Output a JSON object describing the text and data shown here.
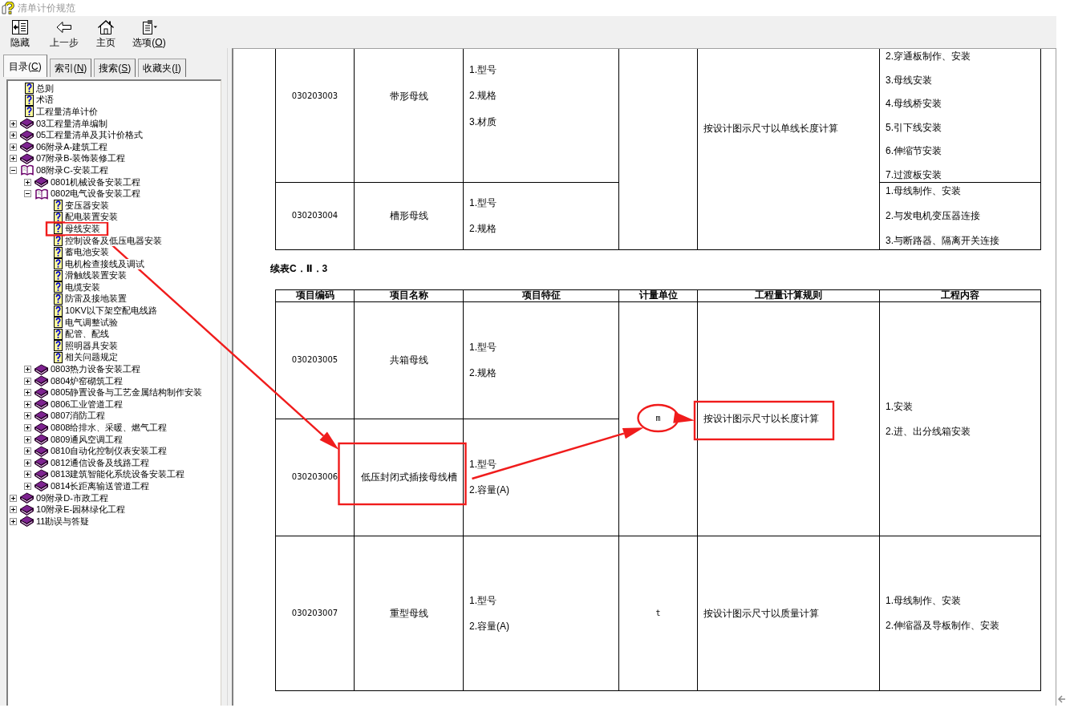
{
  "window": {
    "title": "清单计价规范"
  },
  "toolbar": [
    {
      "label": "隐藏",
      "kind": "hide"
    },
    {
      "label": "上一步",
      "kind": "back"
    },
    {
      "label": "主页",
      "kind": "home"
    },
    {
      "label": "选项(O)",
      "kind": "options"
    }
  ],
  "tabs": [
    {
      "label": "目录(C)",
      "selected": true
    },
    {
      "label": "索引(N)",
      "selected": false
    },
    {
      "label": "搜索(S)",
      "selected": false
    },
    {
      "label": "收藏夹(I)",
      "selected": false
    }
  ],
  "tree": [
    {
      "label": "总则",
      "kind": "page",
      "highlighted": false
    },
    {
      "label": "术语",
      "kind": "page",
      "highlighted": false
    },
    {
      "label": "工程量清单计价",
      "kind": "page",
      "highlighted": false
    },
    {
      "label": "03工程量清单编制",
      "kind": "book",
      "expanded": false,
      "highlighted": false
    },
    {
      "label": "05工程量清单及其计价格式",
      "kind": "book",
      "expanded": false,
      "highlighted": false
    },
    {
      "label": "06附录A-建筑工程",
      "kind": "book",
      "expanded": false,
      "highlighted": false
    },
    {
      "label": "07附录B-装饰装修工程",
      "kind": "book",
      "expanded": false,
      "highlighted": false
    },
    {
      "label": "08附录C-安装工程",
      "kind": "book",
      "expanded": true,
      "highlighted": false,
      "children": [
        {
          "label": "0801机械设备安装工程",
          "kind": "book",
          "expanded": false,
          "highlighted": false
        },
        {
          "label": "0802电气设备安装工程",
          "kind": "book",
          "expanded": true,
          "highlighted": false,
          "children": [
            {
              "label": "变压器安装",
              "kind": "page",
              "highlighted": false
            },
            {
              "label": "配电装置安装",
              "kind": "page",
              "highlighted": false
            },
            {
              "label": "母线安装",
              "kind": "page",
              "highlighted": true
            },
            {
              "label": "控制设备及低压电器安装",
              "kind": "page",
              "highlighted": false
            },
            {
              "label": "蓄电池安装",
              "kind": "page",
              "highlighted": false
            },
            {
              "label": "电机检查接线及调试",
              "kind": "page",
              "highlighted": false
            },
            {
              "label": "滑触线装置安装",
              "kind": "page",
              "highlighted": false
            },
            {
              "label": "电缆安装",
              "kind": "page",
              "highlighted": false
            },
            {
              "label": "防雷及接地装置",
              "kind": "page",
              "highlighted": false
            },
            {
              "label": "10KV以下架空配电线路",
              "kind": "page",
              "highlighted": false
            },
            {
              "label": "电气调整试验",
              "kind": "page",
              "highlighted": false
            },
            {
              "label": "配管、配线",
              "kind": "page",
              "highlighted": false
            },
            {
              "label": "照明器具安装",
              "kind": "page",
              "highlighted": false
            },
            {
              "label": "相关问题规定",
              "kind": "page",
              "highlighted": false
            }
          ]
        },
        {
          "label": "0803热力设备安装工程",
          "kind": "book",
          "expanded": false,
          "highlighted": false
        },
        {
          "label": "0804炉窑砌筑工程",
          "kind": "book",
          "expanded": false,
          "highlighted": false
        },
        {
          "label": "0805静置设备与工艺金属结构制作安装",
          "kind": "book",
          "expanded": false,
          "highlighted": false
        },
        {
          "label": "0806工业管道工程",
          "kind": "book",
          "expanded": false,
          "highlighted": false
        },
        {
          "label": "0807消防工程",
          "kind": "book",
          "expanded": false,
          "highlighted": false
        },
        {
          "label": "0808给排水、采暖、燃气工程",
          "kind": "book",
          "expanded": false,
          "highlighted": false
        },
        {
          "label": "0809通风空调工程",
          "kind": "book",
          "expanded": false,
          "highlighted": false
        },
        {
          "label": "0810自动化控制仪表安装工程",
          "kind": "book",
          "expanded": false,
          "highlighted": false
        },
        {
          "label": "0812通信设备及线路工程",
          "kind": "book",
          "expanded": false,
          "highlighted": false
        },
        {
          "label": "0813建筑智能化系统设备安装工程",
          "kind": "book",
          "expanded": false,
          "highlighted": false
        },
        {
          "label": "0814长距离输送管道工程",
          "kind": "book",
          "expanded": false,
          "highlighted": false
        }
      ]
    },
    {
      "label": "09附录D-市政工程",
      "kind": "book",
      "expanded": false,
      "highlighted": false
    },
    {
      "label": "10附录E-园林绿化工程",
      "kind": "book",
      "expanded": false,
      "highlighted": false
    },
    {
      "label": "11勘误与答疑",
      "kind": "book",
      "expanded": false,
      "highlighted": false
    }
  ],
  "document": {
    "tables": [
      {
        "groups": [
          {
            "rule": "按设计图示尺寸以单线长度计算",
            "rule_highlighted": false,
            "items": [
              {
                "code": "030203003",
                "name": "带形母线",
                "name_highlighted": false,
                "features": [
                  "1.型号",
                  "2.规格",
                  "3.材质"
                ],
                "work": [
                  "2.穿通板制作、安装",
                  "3.母线安装",
                  "4.母线桥安装",
                  "5.引下线安装",
                  "6.伸缩节安装",
                  "7.过渡板安装"
                ]
              },
              {
                "code": "030203004",
                "name": "槽形母线",
                "name_highlighted": false,
                "features": [
                  "1.型号",
                  "2.规格"
                ],
                "work": [
                  "1.母线制作、安装",
                  "2.与发电机变压器连接",
                  "3.与断路器、隔离开关连接"
                ]
              }
            ]
          }
        ]
      },
      {
        "caption": "续表C．Ⅱ．3",
        "columns": [
          "项目编码",
          "项目名称",
          "项目特征",
          "计量单位",
          "工程量计算规则",
          "工程内容"
        ],
        "groups": [
          {
            "unit": "m",
            "unit_circled": true,
            "rule": "按设计图示尺寸以长度计算",
            "rule_highlighted": true,
            "work": [
              "1.安装",
              "2.进、出分线箱安装"
            ],
            "items": [
              {
                "code": "030203005",
                "name": "共箱母线",
                "name_highlighted": false,
                "features": [
                  "1.型号",
                  "2.规格"
                ]
              },
              {
                "code": "030203006",
                "name": "低压封闭式插接母线槽",
                "name_highlighted": true,
                "features": [
                  "1.型号",
                  "2.容量(A)"
                ]
              }
            ]
          },
          {
            "unit": "t",
            "unit_circled": false,
            "rule": "按设计图示尺寸以质量计算",
            "rule_highlighted": false,
            "work": [
              "1.母线制作、安装",
              "2.伸缩器及导板制作、安装"
            ],
            "items": [
              {
                "code": "030203007",
                "name": "重型母线",
                "name_highlighted": false,
                "features": [
                  "1.型号",
                  "2.容量(A)"
                ]
              }
            ]
          }
        ]
      }
    ]
  }
}
